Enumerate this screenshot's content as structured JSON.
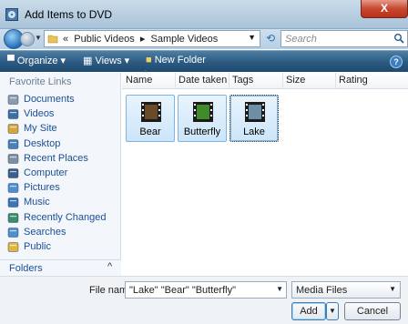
{
  "window": {
    "title": "Add Items to DVD",
    "close_label": "X"
  },
  "address": {
    "prefix": "«",
    "crumbs": [
      "Public Videos",
      "Sample Videos"
    ],
    "separator": "▸",
    "search_placeholder": "Search"
  },
  "toolbar": {
    "organize": "Organize",
    "views": "Views",
    "new_folder": "New Folder",
    "help": "?"
  },
  "sidebar": {
    "title": "Favorite Links",
    "items": [
      {
        "label": "Documents",
        "icon": "documents-icon"
      },
      {
        "label": "Videos",
        "icon": "videos-icon"
      },
      {
        "label": "My Site",
        "icon": "my-site-icon"
      },
      {
        "label": "Desktop",
        "icon": "desktop-icon"
      },
      {
        "label": "Recent Places",
        "icon": "recent-places-icon"
      },
      {
        "label": "Computer",
        "icon": "computer-icon"
      },
      {
        "label": "Pictures",
        "icon": "pictures-icon"
      },
      {
        "label": "Music",
        "icon": "music-icon"
      },
      {
        "label": "Recently Changed",
        "icon": "recently-changed-icon"
      },
      {
        "label": "Searches",
        "icon": "searches-icon"
      },
      {
        "label": "Public",
        "icon": "public-icon"
      }
    ],
    "folders_label": "Folders"
  },
  "columns": [
    "Name",
    "Date taken",
    "Tags",
    "Size",
    "Rating"
  ],
  "files": [
    {
      "name": "Bear",
      "color": "#6b4a2a"
    },
    {
      "name": "Butterfly",
      "color": "#3f8a2a"
    },
    {
      "name": "Lake",
      "color": "#6c8fa7"
    }
  ],
  "footer": {
    "file_name_label": "File name:",
    "file_name_value": "\"Lake\" \"Bear\" \"Butterfly\"",
    "file_type": "Media Files",
    "add_label": "Add",
    "cancel_label": "Cancel"
  },
  "colors": {
    "accent": "#1a4f95",
    "toolbar": "#2c5a82",
    "selection": "#cce5f9"
  }
}
